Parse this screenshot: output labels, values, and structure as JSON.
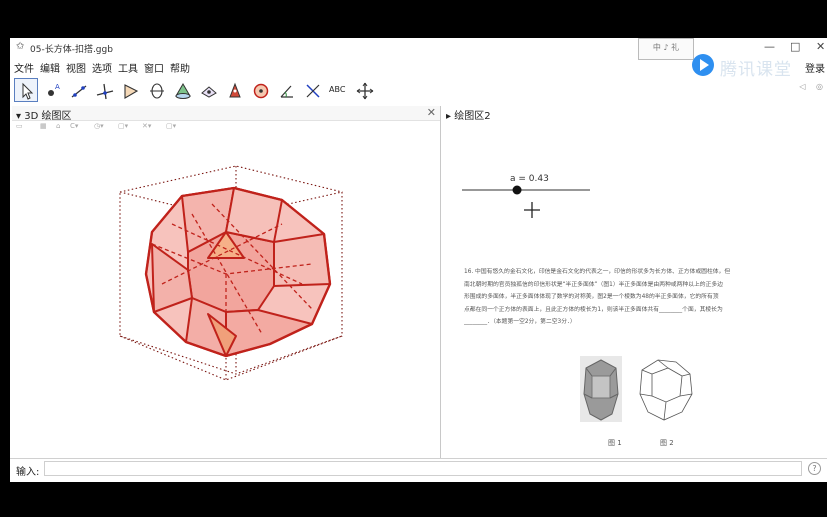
{
  "window": {
    "title": "05-长方体-扣搭.ggb",
    "controls": {
      "minimize": "—",
      "maximize": "□",
      "close": "✕"
    },
    "watermark": "中 ♪ 礼",
    "overlay_brand": "腾讯课堂",
    "login_label": "登录"
  },
  "menu": [
    "文件",
    "编辑",
    "视图",
    "选项",
    "工具",
    "窗口",
    "帮助"
  ],
  "toolbar": {
    "tools": [
      "move-tool",
      "point-tool",
      "line-tool",
      "perpendicular-tool",
      "polygon-tool",
      "circle-tool",
      "pyramid-tool",
      "angle-tool",
      "reflect-tool",
      "sphere-tool",
      "angle-measure-tool",
      "slider-tool",
      "text-tool",
      "move-view-tool"
    ],
    "text_tool_label": "ABC"
  },
  "panel_3d": {
    "title": "3D 绘图区",
    "close": "✕"
  },
  "panel_graphics2": {
    "title": "绘图区2",
    "slider_label": "a = 0.43",
    "slider_value": 0.43
  },
  "problem": {
    "lines": [
      "16. 中国有悠久的金石文化，印信是金石文化的代表之一，印信的形状多为长方体、正方体或圆柱体，但",
      "南北朝时期的官员独孤信的印信形状是“半正多面体”（图1）半正多面体是由两种或两种以上的正多边",
      "形围成的多面体，半正多面体体现了数学的对称美，图2是一个棱数为48的半正多面体，它的所有顶",
      "点都在同一个正方体的表面上，且此正方体的棱长为1，则该半正多面体共有________个面，其棱长为",
      "________．（本题第一空2分，第二空3分．）"
    ],
    "figure_labels": [
      "图 1",
      "图 2"
    ]
  },
  "input_bar": {
    "label": "输入:",
    "value": "",
    "help": "?"
  },
  "colors": {
    "solid_stroke": "#c0221b",
    "solid_fill": "#f4a7a0",
    "cube_dots": "#7a1510",
    "selected_tool_border": "#5a7fc0"
  }
}
